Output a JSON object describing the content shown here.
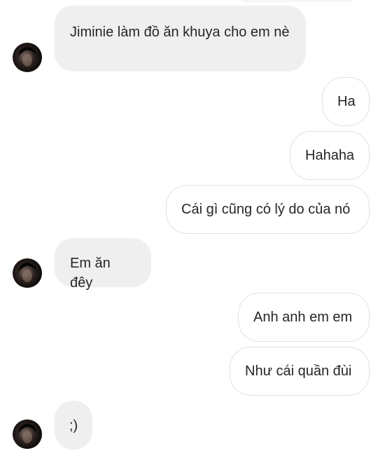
{
  "messages": [
    {
      "id": "m1",
      "side": "incoming",
      "text": "Jiminie làm đồ ăn khuya cho em nè"
    },
    {
      "id": "m2",
      "side": "outgoing",
      "text": "Ha"
    },
    {
      "id": "m3",
      "side": "outgoing",
      "text": "Hahaha"
    },
    {
      "id": "m4",
      "side": "outgoing",
      "text": "Cái gì cũng có lý do của nó"
    },
    {
      "id": "m5",
      "side": "incoming",
      "text": "Em ăn đêy"
    },
    {
      "id": "m6",
      "side": "outgoing",
      "text": "Anh anh em em"
    },
    {
      "id": "m7",
      "side": "outgoing",
      "text": "Như cái quần đùi"
    },
    {
      "id": "m8",
      "side": "incoming",
      "text": ";)"
    }
  ],
  "icons": {
    "avatar": "contact-avatar-icon"
  },
  "colors": {
    "incoming_bg": "#efefef",
    "outgoing_border": "#e2e2e2",
    "text": "#262626"
  }
}
